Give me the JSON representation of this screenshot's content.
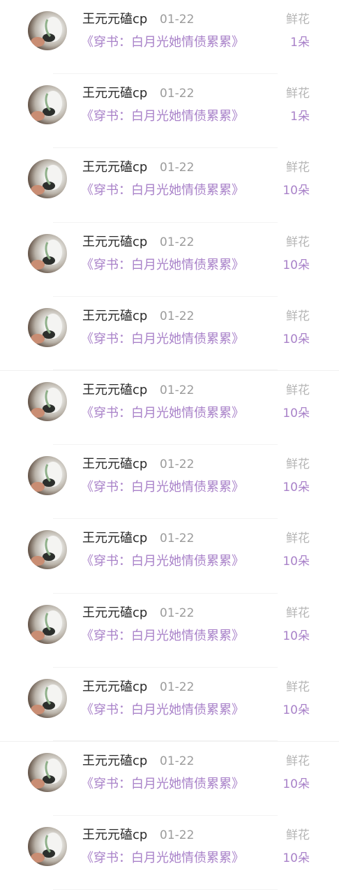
{
  "rows": [
    {
      "user": "王元元磕cp",
      "date": "01-22",
      "gift_type": "鲜花",
      "book": "《穿书：白月光她情债累累》",
      "count": "1朵"
    },
    {
      "user": "王元元磕cp",
      "date": "01-22",
      "gift_type": "鲜花",
      "book": "《穿书：白月光她情债累累》",
      "count": "1朵"
    },
    {
      "user": "王元元磕cp",
      "date": "01-22",
      "gift_type": "鲜花",
      "book": "《穿书：白月光她情债累累》",
      "count": "10朵"
    },
    {
      "user": "王元元磕cp",
      "date": "01-22",
      "gift_type": "鲜花",
      "book": "《穿书：白月光她情债累累》",
      "count": "10朵"
    },
    {
      "user": "王元元磕cp",
      "date": "01-22",
      "gift_type": "鲜花",
      "book": "《穿书：白月光她情债累累》",
      "count": "10朵"
    },
    {
      "user": "王元元磕cp",
      "date": "01-22",
      "gift_type": "鲜花",
      "book": "《穿书：白月光她情债累累》",
      "count": "10朵"
    },
    {
      "user": "王元元磕cp",
      "date": "01-22",
      "gift_type": "鲜花",
      "book": "《穿书：白月光她情债累累》",
      "count": "10朵"
    },
    {
      "user": "王元元磕cp",
      "date": "01-22",
      "gift_type": "鲜花",
      "book": "《穿书：白月光她情债累累》",
      "count": "10朵"
    },
    {
      "user": "王元元磕cp",
      "date": "01-22",
      "gift_type": "鲜花",
      "book": "《穿书：白月光她情债累累》",
      "count": "10朵"
    },
    {
      "user": "王元元磕cp",
      "date": "01-22",
      "gift_type": "鲜花",
      "book": "《穿书：白月光她情债累累》",
      "count": "10朵"
    },
    {
      "user": "王元元磕cp",
      "date": "01-22",
      "gift_type": "鲜花",
      "book": "《穿书：白月光她情债累累》",
      "count": "10朵"
    },
    {
      "user": "王元元磕cp",
      "date": "01-22",
      "gift_type": "鲜花",
      "book": "《穿书：白月光她情债累累》",
      "count": "10朵"
    }
  ],
  "colors": {
    "name": "#2b2b2b",
    "date": "#9b9b9b",
    "gift_type": "#b6b6b6",
    "accent_purple": "#a982c9"
  }
}
